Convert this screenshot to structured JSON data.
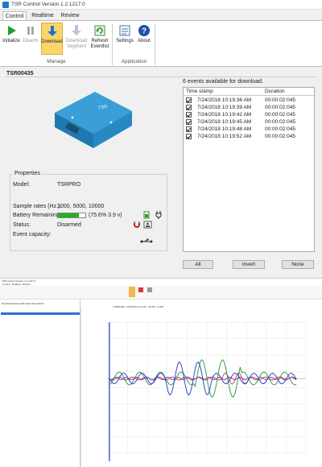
{
  "window": {
    "title": "TSR Control Version 1.2.1217.0"
  },
  "tabs": [
    {
      "label": "Control"
    },
    {
      "label": "Realtime"
    },
    {
      "label": "Review"
    }
  ],
  "ribbon": {
    "manage_group": "Manage",
    "application_group": "Application",
    "buttons": {
      "initialize": "Initialize",
      "disarm": "Disarm",
      "download": "Download",
      "download_segment_1": "Download",
      "download_segment_2": "Segment",
      "refresh_1": "Refresh",
      "refresh_2": "Eventlist",
      "settings": "Settings",
      "about": "About"
    }
  },
  "device": {
    "id": "TSR00435",
    "label": "TSR"
  },
  "properties": {
    "title": "Properties",
    "model_label": "Model:",
    "model_value": "TSRPRO",
    "rates_label": "Sample rates (Hz.):",
    "rates_value": "1000, 5000, 10000",
    "battery_label": "Battery Remaining:",
    "battery_value": "(75.6%  3.9 v)",
    "battery_fraction": 0.756,
    "status_label": "Status:",
    "status_value": "Disarmed",
    "capacity_label": "Event capacity:"
  },
  "events": {
    "header": "6 events  available for download.",
    "col_timestamp": "Time stamp",
    "col_duration": "Duration",
    "rows": [
      {
        "timestamp": "7/24/2018 10:19:36 AM",
        "duration": "00:00:02:045"
      },
      {
        "timestamp": "7/24/2018 10:19:39 AM",
        "duration": "00:00:02:045"
      },
      {
        "timestamp": "7/24/2018 10:19:42 AM",
        "duration": "00:00:02:045"
      },
      {
        "timestamp": "7/24/2018 10:19:45 AM",
        "duration": "00:00:02:045"
      },
      {
        "timestamp": "7/24/2018 10:19:48 AM",
        "duration": "00:00:02:045"
      },
      {
        "timestamp": "7/24/2018 10:19:52 AM",
        "duration": "00:00:02:045"
      }
    ],
    "btn_all": "All",
    "btn_invert": "Invert",
    "btn_none": "None"
  },
  "review_window": {
    "title": "TSR Control Version 1.2.1217.0",
    "tabs": [
      "Control",
      "Realtime",
      "Review"
    ],
    "tree_headers": [
      "Downloaded Events",
      "Duration",
      "Description"
    ],
    "chart_title": "TSR00435 > 2018-08-12 11:03 > 10:56 > 2.045",
    "colors": {
      "blue": "#2233cc",
      "red": "#d42a2a",
      "green": "#1e9a2c",
      "purple": "#8a2ad0"
    }
  }
}
